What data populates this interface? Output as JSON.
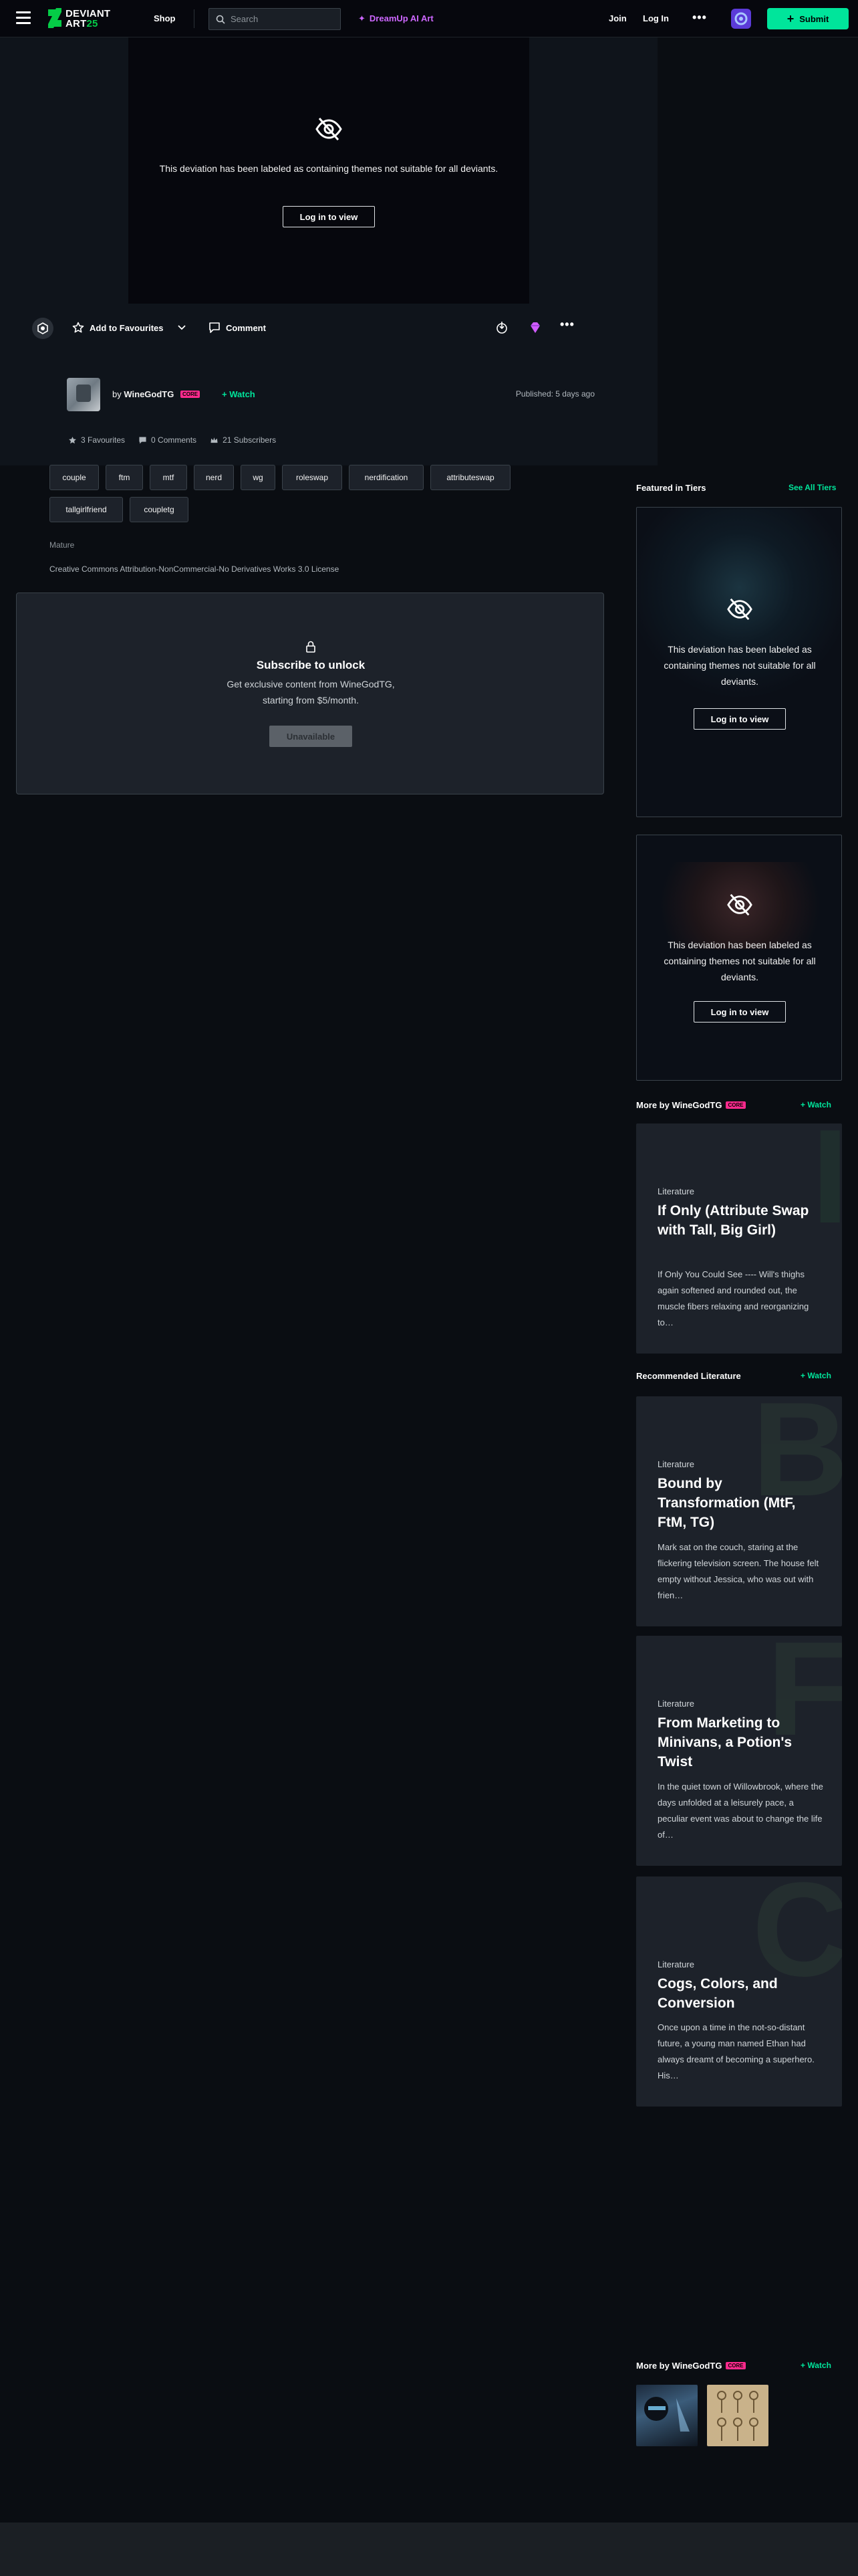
{
  "nav": {
    "logo_line1": "DEVIANT",
    "logo_line2": "ART",
    "logo_badge": "25",
    "shop": "Shop",
    "search_placeholder": "Search",
    "dreamup": "DreamUp AI Art",
    "join": "Join",
    "login": "Log In",
    "more": "•••",
    "submit": "Submit"
  },
  "deviation": {
    "mature_message": "This deviation has been labeled as containing themes not suitable for all deviants.",
    "login_button": "Log in to view"
  },
  "actions": {
    "favourite": "Add to Favourites",
    "comment": "Comment",
    "more": "•••"
  },
  "author": {
    "by": "by",
    "name": "WineGodTG",
    "badge": "CORE",
    "watch": "Watch",
    "published": "Published: 5 days ago"
  },
  "stats": {
    "favourites": "3 Favourites",
    "comments": "0 Comments",
    "subscribers": "21 Subscribers"
  },
  "tags": [
    "couple",
    "ftm",
    "mtf",
    "nerd",
    "wg",
    "roleswap",
    "nerdification",
    "attributeswap",
    "tallgirlfriend",
    "coupletg"
  ],
  "mature_label": "Mature",
  "license": "Creative Commons Attribution-NonCommercial-No Derivatives Works 3.0 License",
  "subscribe": {
    "title": "Subscribe to unlock",
    "desc": "Get exclusive content from WineGodTG, starting from $5/month.",
    "button": "Unavailable"
  },
  "sidebar": {
    "featured_title": "Featured in Tiers",
    "see_all": "See All Tiers",
    "tier_message": "This deviation has been labeled as containing themes not suitable for all deviants.",
    "tier_button": "Log in to view",
    "more_by_title": "More by WineGodTG",
    "more_by_badge": "CORE",
    "watch": "Watch",
    "recommended_title": "Recommended Literature",
    "more_by_card": {
      "category": "Literature",
      "title": "If Only (Attribute Swap with Tall, Big Girl)",
      "excerpt": "If Only You Could See ---- Will's thighs again softened and rounded out, the muscle fibers relaxing and reorganizing to…"
    },
    "recommended": [
      {
        "letter": "B",
        "category": "Literature",
        "title": "Bound by Transformation (MtF, FtM, TG)",
        "excerpt": "Mark sat on the couch, staring at the flickering television screen. The house felt empty without Jessica, who was out with frien…"
      },
      {
        "letter": "F",
        "category": "Literature",
        "title": "From Marketing to Minivans, a Potion's Twist",
        "excerpt": "In the quiet town of Willowbrook, where the days unfolded at a leisurely pace, a peculiar event was about to change the life of…"
      },
      {
        "letter": "C",
        "category": "Literature",
        "title": "Cogs, Colors, and Conversion",
        "excerpt": "Once upon a time in the not-so-distant future, a young man named Ethan had always dreamt of becoming a superhero. His…"
      }
    ],
    "more_by_bottom_title": "More by WineGodTG",
    "more_by_bottom_badge": "CORE"
  },
  "colors": {
    "accent": "#00e59b",
    "core_badge": "#ff2a8e",
    "dreamup": "#cd67ff",
    "background": "#0a0d12"
  }
}
